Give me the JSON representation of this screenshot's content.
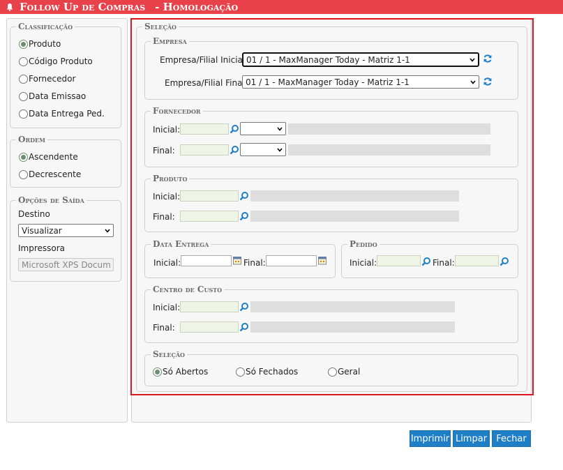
{
  "title": {
    "main": "Follow Up de Compras",
    "sub": "- Homologação"
  },
  "left": {
    "classificacao": {
      "legend": "Classificação",
      "options": [
        "Produto",
        "Código Produto",
        "Fornecedor",
        "Data Emissao",
        "Data Entrega Ped."
      ],
      "selected": "Produto"
    },
    "ordem": {
      "legend": "Ordem",
      "options": [
        "Ascendente",
        "Decrescente"
      ],
      "selected": "Ascendente"
    },
    "saida": {
      "legend": "Opções de Saída",
      "destino_label": "Destino",
      "destino_value": "Visualizar",
      "impressora_label": "Impressora",
      "impressora_value": "Microsoft XPS Docum"
    }
  },
  "main": {
    "selecao_legend": "Seleção",
    "empresa": {
      "legend": "Empresa",
      "inicial_label": "Empresa/Filial Inicial:",
      "inicial_value": "01 / 1 - MaxManager Today - Matriz 1-1",
      "final_label": "Empresa/Filial Final:",
      "final_value": "01 / 1 - MaxManager Today - Matriz 1-1"
    },
    "fornecedor": {
      "legend": "Fornecedor",
      "inicial_label": "Inicial:",
      "final_label": "Final:"
    },
    "produto": {
      "legend": "Produto",
      "inicial_label": "Inicial:",
      "final_label": "Final:"
    },
    "data_entrega": {
      "legend": "Data Entrega",
      "inicial_label": "Inicial:",
      "final_label": "Final:"
    },
    "pedido": {
      "legend": "Pedido",
      "inicial_label": "Inicial:",
      "final_label": "Final:"
    },
    "centro_custo": {
      "legend": "Centro de Custo",
      "inicial_label": "Inicial:",
      "final_label": "Final:"
    },
    "selecao_status": {
      "legend": "Seleção",
      "options": [
        "Só Abertos",
        "Só Fechados",
        "Geral"
      ],
      "selected": "Só Abertos"
    }
  },
  "buttons": {
    "imprimir": "Imprimir",
    "limpar": "Limpar",
    "fechar": "Fechar"
  },
  "colors": {
    "titlebar": "#e8414a",
    "button": "#1e7fc6",
    "highlight": "#e0161d",
    "lookup_input": "#eef4e6"
  }
}
